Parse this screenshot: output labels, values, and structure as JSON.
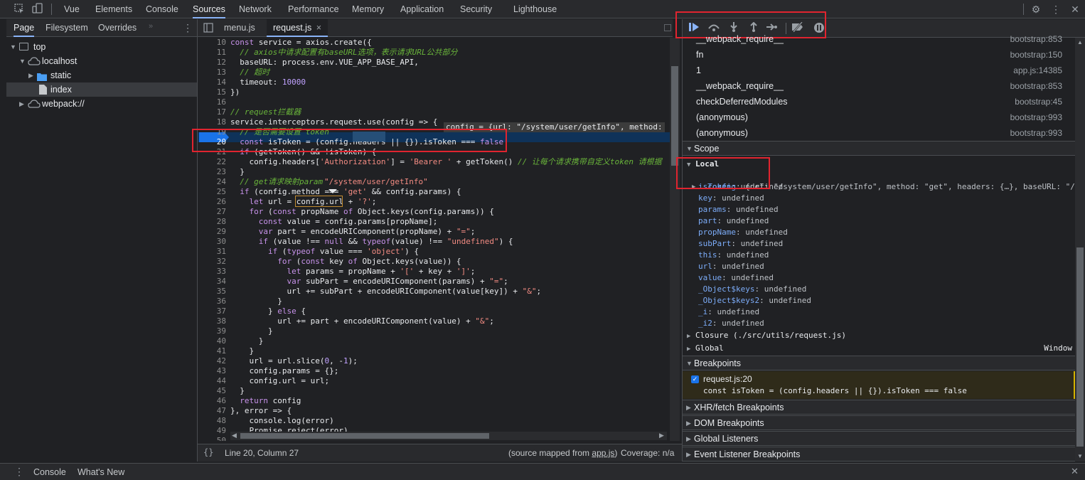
{
  "toptabs": [
    "Vue",
    "Elements",
    "Console",
    "Sources",
    "Network",
    "Performance",
    "Memory",
    "Application",
    "Security",
    "Lighthouse"
  ],
  "active_toptab": "Sources",
  "navigator": {
    "tabs": [
      "Page",
      "Filesystem",
      "Overrides"
    ],
    "tree": [
      {
        "label": "top"
      },
      {
        "label": "localhost"
      },
      {
        "label": "static"
      },
      {
        "label": "index"
      },
      {
        "label": "webpack://"
      }
    ]
  },
  "editor": {
    "tabs": [
      {
        "label": "menu.js"
      },
      {
        "label": "request.js",
        "close": "×"
      }
    ],
    "inline_value": "config = {url: \"/system/user/getInfo\", method:",
    "hover_value": "\"/system/user/getInfo\"",
    "lines": [
      {
        "n": "10",
        "t": "const service = axios.create({"
      },
      {
        "n": "11",
        "t": "  // axios中请求配置有baseURL选项，表示请求URL公共部分"
      },
      {
        "n": "12",
        "t": "  baseURL: process.env.VUE_APP_BASE_API,"
      },
      {
        "n": "13",
        "t": "  // 超时"
      },
      {
        "n": "14",
        "t": "  timeout: 10000"
      },
      {
        "n": "15",
        "t": "})"
      },
      {
        "n": "16",
        "t": ""
      },
      {
        "n": "17",
        "t": "// request拦截器"
      },
      {
        "n": "18",
        "t": "service.interceptors.request.use(config => {"
      },
      {
        "n": "19",
        "t": "  // 是否需要设置 token"
      },
      {
        "n": "20",
        "t": "  const isToken = (config.headers || {}).isToken === false"
      },
      {
        "n": "21",
        "t": "  if (getToken() && !isToken) {"
      },
      {
        "n": "22",
        "t": "    config.headers['Authorization'] = 'Bearer ' + getToken() // 让每个请求携带自定义token 请根据"
      },
      {
        "n": "23",
        "t": "  }"
      },
      {
        "n": "24",
        "t": "  // get请求映射params参数"
      },
      {
        "n": "25",
        "t": "  if (config.method === 'get' && config.params) {"
      },
      {
        "n": "26",
        "t": "    let url = config.url + '?';"
      },
      {
        "n": "27",
        "t": "    for (const propName of Object.keys(config.params)) {"
      },
      {
        "n": "28",
        "t": "      const value = config.params[propName];"
      },
      {
        "n": "29",
        "t": "      var part = encodeURIComponent(propName) + \"=\";"
      },
      {
        "n": "30",
        "t": "      if (value !== null && typeof(value) !== \"undefined\") {"
      },
      {
        "n": "31",
        "t": "        if (typeof value === 'object') {"
      },
      {
        "n": "32",
        "t": "          for (const key of Object.keys(value)) {"
      },
      {
        "n": "33",
        "t": "            let params = propName + '[' + key + ']';"
      },
      {
        "n": "34",
        "t": "            var subPart = encodeURIComponent(params) + \"=\";"
      },
      {
        "n": "35",
        "t": "            url += subPart + encodeURIComponent(value[key]) + \"&\";"
      },
      {
        "n": "36",
        "t": "          }"
      },
      {
        "n": "37",
        "t": "        } else {"
      },
      {
        "n": "38",
        "t": "          url += part + encodeURIComponent(value) + \"&\";"
      },
      {
        "n": "39",
        "t": "        }"
      },
      {
        "n": "40",
        "t": "      }"
      },
      {
        "n": "41",
        "t": "    }"
      },
      {
        "n": "42",
        "t": "    url = url.slice(0, -1);"
      },
      {
        "n": "43",
        "t": "    config.params = {};"
      },
      {
        "n": "44",
        "t": "    config.url = url;"
      },
      {
        "n": "45",
        "t": "  }"
      },
      {
        "n": "46",
        "t": "  return config"
      },
      {
        "n": "47",
        "t": "}, error => {"
      },
      {
        "n": "48",
        "t": "    console.log(error)"
      },
      {
        "n": "49",
        "t": "    Promise.reject(error)"
      },
      {
        "n": "50",
        "t": ""
      }
    ],
    "status_left": "Line 20, Column 27",
    "status_source_prefix": "(source mapped from ",
    "status_source_file": "app.js",
    "status_source_suffix": ")",
    "status_coverage": "Coverage: n/a"
  },
  "callstack": [
    {
      "fn": "__webpack_require__",
      "loc": "bootstrap:853"
    },
    {
      "fn": "fn",
      "loc": "bootstrap:150"
    },
    {
      "fn": "1",
      "loc": "app.js:14385"
    },
    {
      "fn": "__webpack_require__",
      "loc": "bootstrap:853"
    },
    {
      "fn": "checkDeferredModules",
      "loc": "bootstrap:45"
    },
    {
      "fn": "(anonymous)",
      "loc": "bootstrap:993"
    },
    {
      "fn": "(anonymous)",
      "loc": "bootstrap:993"
    }
  ],
  "scope": {
    "title": "Scope",
    "local_label": "Local",
    "config_key": "config",
    "config_value": ": {url: \"/system/user/getInfo\", method: \"get\", headers: {…}, baseURL: \"/d…",
    "vars": [
      {
        "k": "isToken",
        "v": ": undefined"
      },
      {
        "k": "key",
        "v": ": undefined"
      },
      {
        "k": "params",
        "v": ": undefined"
      },
      {
        "k": "part",
        "v": ": undefined"
      },
      {
        "k": "propName",
        "v": ": undefined"
      },
      {
        "k": "subPart",
        "v": ": undefined"
      },
      {
        "k": "this",
        "v": ": undefined"
      },
      {
        "k": "url",
        "v": ": undefined"
      },
      {
        "k": "value",
        "v": ": undefined"
      },
      {
        "k": "_Object$keys",
        "v": ": undefined"
      },
      {
        "k": "_Object$keys2",
        "v": ": undefined"
      },
      {
        "k": "_i",
        "v": ": undefined"
      },
      {
        "k": "_i2",
        "v": ": undefined"
      }
    ],
    "closure": "Closure (./src/utils/request.js)",
    "global": "Global",
    "global_value": "Window"
  },
  "breakpoints": {
    "title": "Breakpoints",
    "item_label": "request.js:20",
    "item_code": "const isToken = (config.headers || {}).isToken === false"
  },
  "sections": [
    "XHR/fetch Breakpoints",
    "DOM Breakpoints",
    "Global Listeners",
    "Event Listener Breakpoints"
  ],
  "drawer_tabs": [
    "Console",
    "What's New"
  ],
  "colors": {
    "accent": "#8ab4f8",
    "highlight": "#e0242f",
    "breakpoint": "#1a73e8"
  }
}
